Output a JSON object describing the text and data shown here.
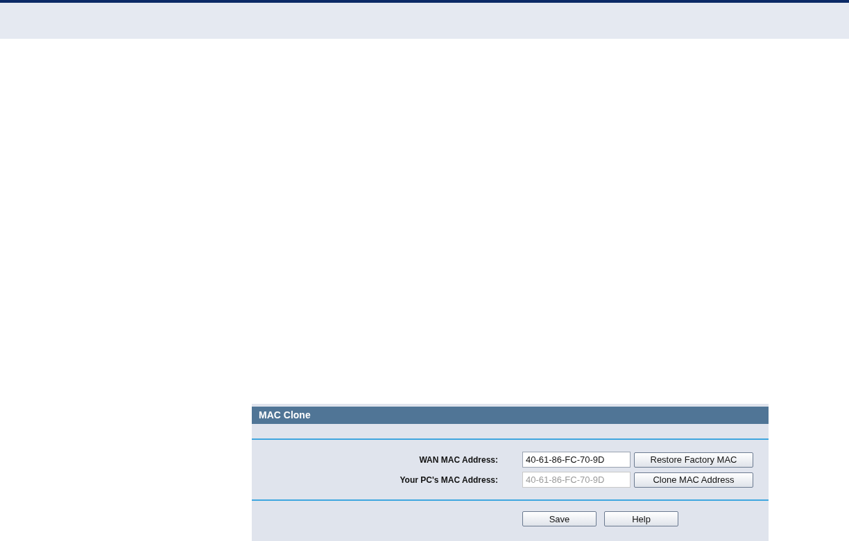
{
  "panel": {
    "title": "MAC Clone"
  },
  "fields": [
    {
      "label": "WAN MAC Address:",
      "value": "40-61-86-FC-70-9D",
      "disabled": false,
      "button": "Restore Factory MAC"
    },
    {
      "label": "Your PC's MAC Address:",
      "value": "40-61-86-FC-70-9D",
      "disabled": true,
      "button": "Clone MAC Address"
    }
  ],
  "buttons": [
    "Save",
    "Help"
  ]
}
